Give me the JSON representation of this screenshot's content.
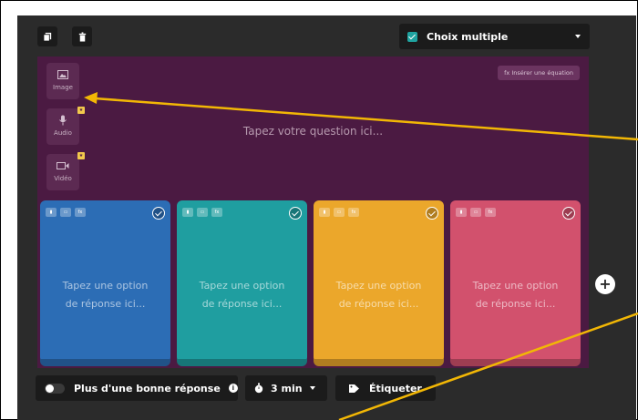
{
  "question_type": {
    "label": "Choix multiple"
  },
  "question": {
    "placeholder": "Tapez votre question ici...",
    "equation_button": "fx Insérer une équation",
    "media": [
      {
        "label": "Image",
        "icon": "image-icon",
        "badge": false
      },
      {
        "label": "Audio",
        "icon": "microphone-icon",
        "badge": true
      },
      {
        "label": "Vidéo",
        "icon": "video-icon",
        "badge": true
      }
    ]
  },
  "options": [
    {
      "line1": "Tapez une option",
      "line2": "de réponse ici...",
      "color": "#2c6db5"
    },
    {
      "line1": "Tapez une option",
      "line2": "de réponse ici...",
      "color": "#1f9ea0"
    },
    {
      "line1": "Tapez une option",
      "line2": "de réponse ici...",
      "color": "#eba72b"
    },
    {
      "line1": "Tapez une option",
      "line2": "de réponse ici...",
      "color": "#d2516d"
    }
  ],
  "bottom_bar": {
    "multiple_correct_label": "Plus d'une bonne réponse",
    "time_label": "3 min",
    "tag_label": "Étiqueter"
  },
  "annotation_color": "#f2b705"
}
